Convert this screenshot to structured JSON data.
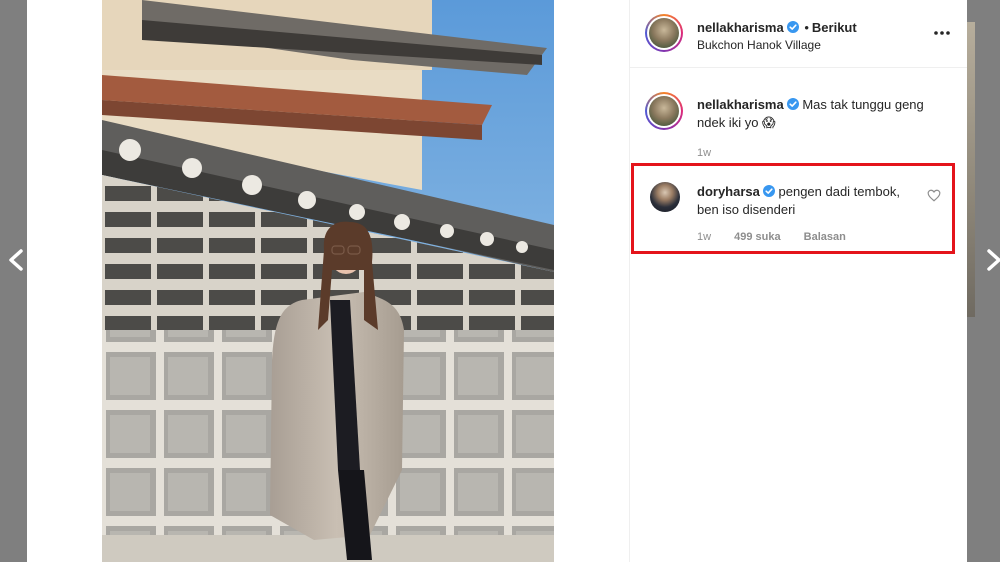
{
  "post": {
    "author": {
      "username": "nellakharisma",
      "follow_label": "Berikut",
      "separator": "•",
      "location": "Bukchon Hanok Village"
    },
    "caption": {
      "username": "nellakharisma",
      "text": "Mas tak tunggu geng ndek iki yo",
      "emoji": "😱",
      "time": "1w"
    }
  },
  "comment": {
    "username": "doryharsa",
    "text": "pengen dadi tembok, ben iso disenderi",
    "time": "1w",
    "likes": "499 suka",
    "reply_label": "Balasan"
  },
  "icons": {
    "verified": "verified-badge-icon",
    "more": "more-options-icon",
    "heart": "heart-outline-icon",
    "prev": "chevron-left-icon",
    "next": "chevron-right-icon"
  },
  "colors": {
    "verified_blue": "#3897f0",
    "highlight_red": "#e4141b",
    "text_primary": "#262626",
    "text_secondary": "#8e8e8e"
  }
}
